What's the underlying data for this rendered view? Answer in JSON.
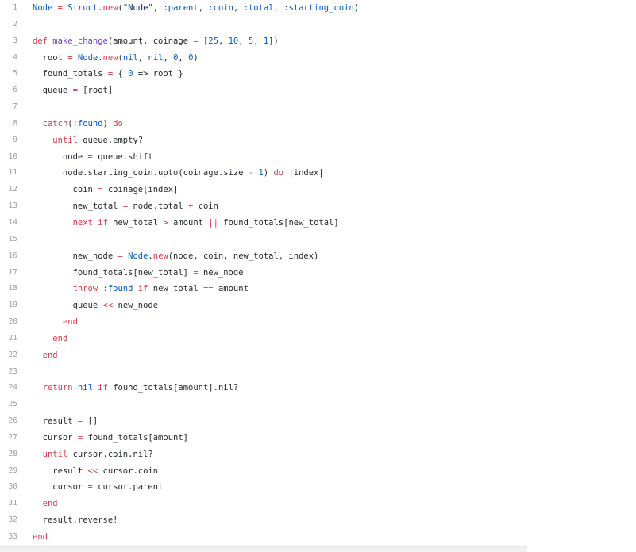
{
  "editor": {
    "lines": [
      {
        "n": "1",
        "tokens": [
          [
            "const",
            "Node"
          ],
          [
            "plain",
            " "
          ],
          [
            "op",
            "="
          ],
          [
            "plain",
            " "
          ],
          [
            "const",
            "Struct"
          ],
          [
            "plain",
            "."
          ],
          [
            "kw",
            "new"
          ],
          [
            "plain",
            "("
          ],
          [
            "str",
            "\"Node\""
          ],
          [
            "plain",
            ", "
          ],
          [
            "sym",
            ":parent"
          ],
          [
            "plain",
            ", "
          ],
          [
            "sym",
            ":coin"
          ],
          [
            "plain",
            ", "
          ],
          [
            "sym",
            ":total"
          ],
          [
            "plain",
            ", "
          ],
          [
            "sym",
            ":starting_coin"
          ],
          [
            "plain",
            ")"
          ]
        ]
      },
      {
        "n": "2",
        "tokens": []
      },
      {
        "n": "3",
        "tokens": [
          [
            "kw",
            "def"
          ],
          [
            "plain",
            " "
          ],
          [
            "fn",
            "make_change"
          ],
          [
            "plain",
            "(amount, coinage "
          ],
          [
            "op",
            "="
          ],
          [
            "plain",
            " ["
          ],
          [
            "num",
            "25"
          ],
          [
            "plain",
            ", "
          ],
          [
            "num",
            "10"
          ],
          [
            "plain",
            ", "
          ],
          [
            "num",
            "5"
          ],
          [
            "plain",
            ", "
          ],
          [
            "num",
            "1"
          ],
          [
            "plain",
            "])"
          ]
        ]
      },
      {
        "n": "4",
        "tokens": [
          [
            "plain",
            "  root "
          ],
          [
            "op",
            "="
          ],
          [
            "plain",
            " "
          ],
          [
            "const",
            "Node"
          ],
          [
            "plain",
            "."
          ],
          [
            "kw",
            "new"
          ],
          [
            "plain",
            "("
          ],
          [
            "const",
            "nil"
          ],
          [
            "plain",
            ", "
          ],
          [
            "const",
            "nil"
          ],
          [
            "plain",
            ", "
          ],
          [
            "num",
            "0"
          ],
          [
            "plain",
            ", "
          ],
          [
            "num",
            "0"
          ],
          [
            "plain",
            ")"
          ]
        ]
      },
      {
        "n": "5",
        "tokens": [
          [
            "plain",
            "  found_totals "
          ],
          [
            "op",
            "="
          ],
          [
            "plain",
            " { "
          ],
          [
            "num",
            "0"
          ],
          [
            "plain",
            " => root }"
          ]
        ]
      },
      {
        "n": "6",
        "tokens": [
          [
            "plain",
            "  queue "
          ],
          [
            "op",
            "="
          ],
          [
            "plain",
            " [root]"
          ]
        ]
      },
      {
        "n": "7",
        "tokens": []
      },
      {
        "n": "8",
        "tokens": [
          [
            "plain",
            "  "
          ],
          [
            "kw",
            "catch"
          ],
          [
            "plain",
            "("
          ],
          [
            "sym",
            ":found"
          ],
          [
            "plain",
            ") "
          ],
          [
            "kw",
            "do"
          ]
        ]
      },
      {
        "n": "9",
        "tokens": [
          [
            "plain",
            "    "
          ],
          [
            "kw",
            "until"
          ],
          [
            "plain",
            " queue.empty?"
          ]
        ]
      },
      {
        "n": "10",
        "tokens": [
          [
            "plain",
            "      node "
          ],
          [
            "op",
            "="
          ],
          [
            "plain",
            " queue.shift"
          ]
        ]
      },
      {
        "n": "11",
        "tokens": [
          [
            "plain",
            "      node.starting_coin.upto(coinage.size "
          ],
          [
            "op",
            "-"
          ],
          [
            "plain",
            " "
          ],
          [
            "num",
            "1"
          ],
          [
            "plain",
            ") "
          ],
          [
            "kw",
            "do"
          ],
          [
            "plain",
            " |index|"
          ]
        ]
      },
      {
        "n": "12",
        "tokens": [
          [
            "plain",
            "        coin "
          ],
          [
            "op",
            "="
          ],
          [
            "plain",
            " coinage[index]"
          ]
        ]
      },
      {
        "n": "13",
        "tokens": [
          [
            "plain",
            "        new_total "
          ],
          [
            "op",
            "="
          ],
          [
            "plain",
            " node.total "
          ],
          [
            "op",
            "+"
          ],
          [
            "plain",
            " coin"
          ]
        ]
      },
      {
        "n": "14",
        "tokens": [
          [
            "plain",
            "        "
          ],
          [
            "kw",
            "next"
          ],
          [
            "plain",
            " "
          ],
          [
            "kw",
            "if"
          ],
          [
            "plain",
            " new_total "
          ],
          [
            "op",
            ">"
          ],
          [
            "plain",
            " amount "
          ],
          [
            "op",
            "||"
          ],
          [
            "plain",
            " found_totals[new_total]"
          ]
        ]
      },
      {
        "n": "15",
        "tokens": []
      },
      {
        "n": "16",
        "tokens": [
          [
            "plain",
            "        new_node "
          ],
          [
            "op",
            "="
          ],
          [
            "plain",
            " "
          ],
          [
            "const",
            "Node"
          ],
          [
            "plain",
            "."
          ],
          [
            "kw",
            "new"
          ],
          [
            "plain",
            "(node, coin, new_total, index)"
          ]
        ]
      },
      {
        "n": "17",
        "tokens": [
          [
            "plain",
            "        found_totals[new_total] "
          ],
          [
            "op",
            "="
          ],
          [
            "plain",
            " new_node"
          ]
        ]
      },
      {
        "n": "18",
        "tokens": [
          [
            "plain",
            "        "
          ],
          [
            "kw",
            "throw"
          ],
          [
            "plain",
            " "
          ],
          [
            "sym",
            ":found"
          ],
          [
            "plain",
            " "
          ],
          [
            "kw",
            "if"
          ],
          [
            "plain",
            " new_total "
          ],
          [
            "op",
            "=="
          ],
          [
            "plain",
            " amount"
          ]
        ]
      },
      {
        "n": "19",
        "tokens": [
          [
            "plain",
            "        queue "
          ],
          [
            "op",
            "<<"
          ],
          [
            "plain",
            " new_node"
          ]
        ]
      },
      {
        "n": "20",
        "tokens": [
          [
            "plain",
            "      "
          ],
          [
            "kw",
            "end"
          ]
        ]
      },
      {
        "n": "21",
        "tokens": [
          [
            "plain",
            "    "
          ],
          [
            "kw",
            "end"
          ]
        ]
      },
      {
        "n": "22",
        "tokens": [
          [
            "plain",
            "  "
          ],
          [
            "kw",
            "end"
          ]
        ]
      },
      {
        "n": "23",
        "tokens": []
      },
      {
        "n": "24",
        "tokens": [
          [
            "plain",
            "  "
          ],
          [
            "kw",
            "return"
          ],
          [
            "plain",
            " "
          ],
          [
            "const",
            "nil"
          ],
          [
            "plain",
            " "
          ],
          [
            "kw",
            "if"
          ],
          [
            "plain",
            " found_totals[amount].nil?"
          ]
        ]
      },
      {
        "n": "25",
        "tokens": []
      },
      {
        "n": "26",
        "tokens": [
          [
            "plain",
            "  result "
          ],
          [
            "op",
            "="
          ],
          [
            "plain",
            " []"
          ]
        ]
      },
      {
        "n": "27",
        "tokens": [
          [
            "plain",
            "  cursor "
          ],
          [
            "op",
            "="
          ],
          [
            "plain",
            " found_totals[amount]"
          ]
        ]
      },
      {
        "n": "28",
        "tokens": [
          [
            "plain",
            "  "
          ],
          [
            "kw",
            "until"
          ],
          [
            "plain",
            " cursor.coin.nil?"
          ]
        ]
      },
      {
        "n": "29",
        "tokens": [
          [
            "plain",
            "    result "
          ],
          [
            "op",
            "<<"
          ],
          [
            "plain",
            " cursor.coin"
          ]
        ]
      },
      {
        "n": "30",
        "tokens": [
          [
            "plain",
            "    cursor "
          ],
          [
            "op",
            "="
          ],
          [
            "plain",
            " cursor.parent"
          ]
        ]
      },
      {
        "n": "31",
        "tokens": [
          [
            "plain",
            "  "
          ],
          [
            "kw",
            "end"
          ]
        ]
      },
      {
        "n": "32",
        "tokens": [
          [
            "plain",
            "  result.reverse!"
          ]
        ]
      },
      {
        "n": "33",
        "tokens": [
          [
            "kw",
            "end"
          ]
        ]
      }
    ]
  },
  "colors": {
    "keyword": "#d73a49",
    "constant": "#005cc5",
    "function": "#6f42c1",
    "string": "#032f62",
    "text": "#24292e",
    "line_number": "#9aa0a6"
  }
}
